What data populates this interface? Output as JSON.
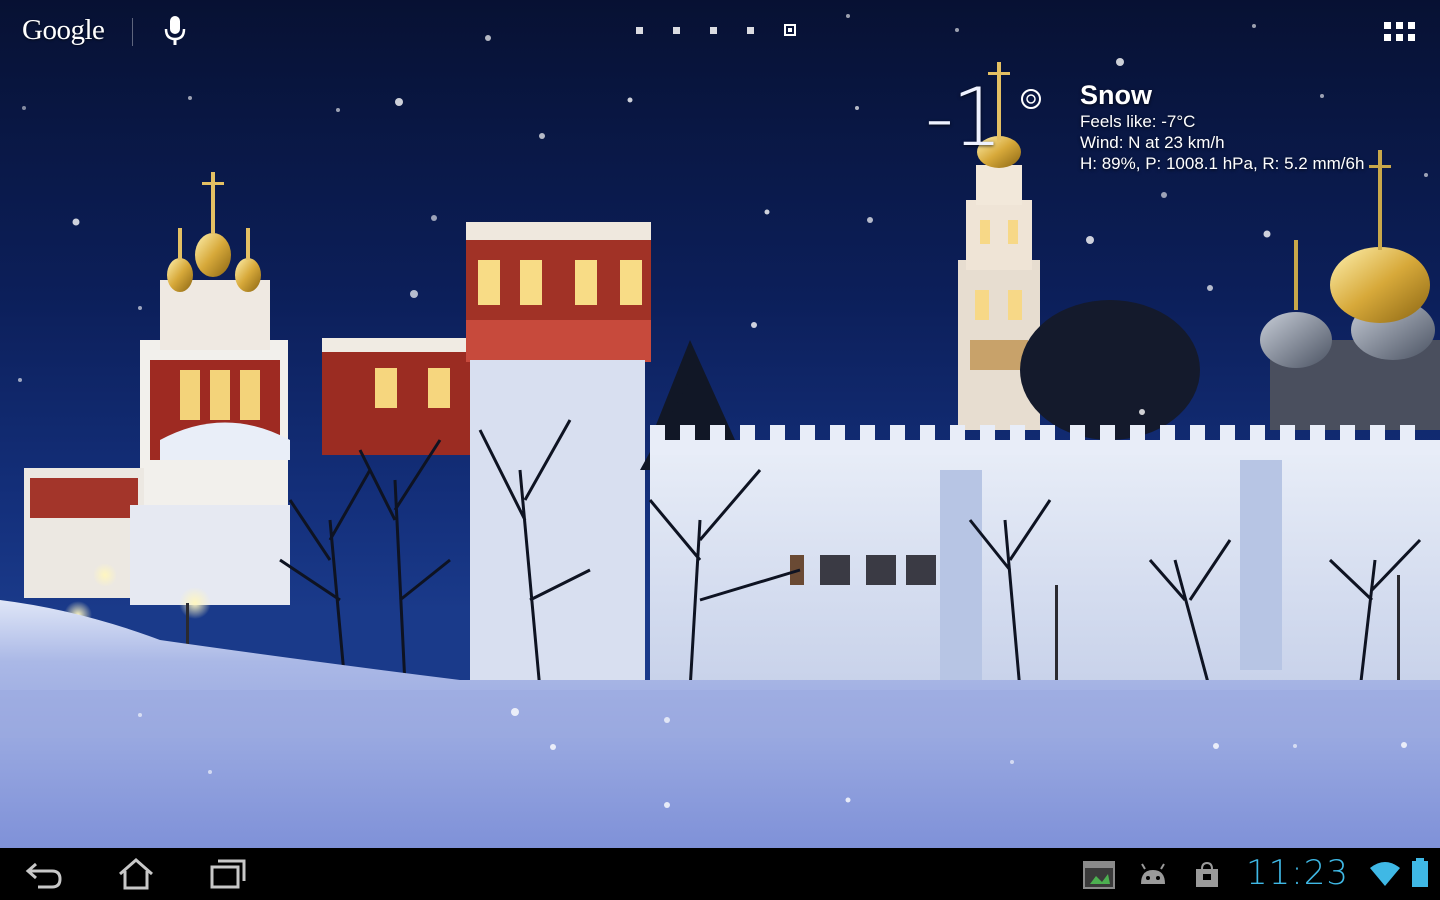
{
  "search_bar": {
    "logo_text": "Google",
    "mic_icon": "microphone-icon"
  },
  "page_indicator": {
    "count": 5,
    "current": 5
  },
  "apps_icon": "all-apps-grid-icon",
  "weather": {
    "temperature": "-1",
    "degree_icon": "degree-circle-icon",
    "condition": "Snow",
    "feels_like": "Feels like: -7°C",
    "wind": "Wind: N at 23 km/h",
    "details": "H: 89%, P: 1008.1 hPa, R: 5.2 mm/6h"
  },
  "navigation": {
    "back_icon": "back-arrow-icon",
    "home_icon": "home-icon",
    "recent_icon": "recent-apps-icon"
  },
  "status": {
    "notification_icons": [
      "gallery-notification-icon",
      "android-debug-icon",
      "store-bag-icon"
    ],
    "time": "11:23",
    "wifi_icon": "wifi-icon",
    "battery_icon": "battery-icon"
  },
  "colors": {
    "sky_top": "#071133",
    "sky_bottom": "#1a3a8a",
    "snow": "#e8ecf8",
    "clock": "#3fb8e5",
    "navbar": "#000000"
  },
  "wallpaper": {
    "subject": "snowy-monastery-night-wallpaper"
  }
}
